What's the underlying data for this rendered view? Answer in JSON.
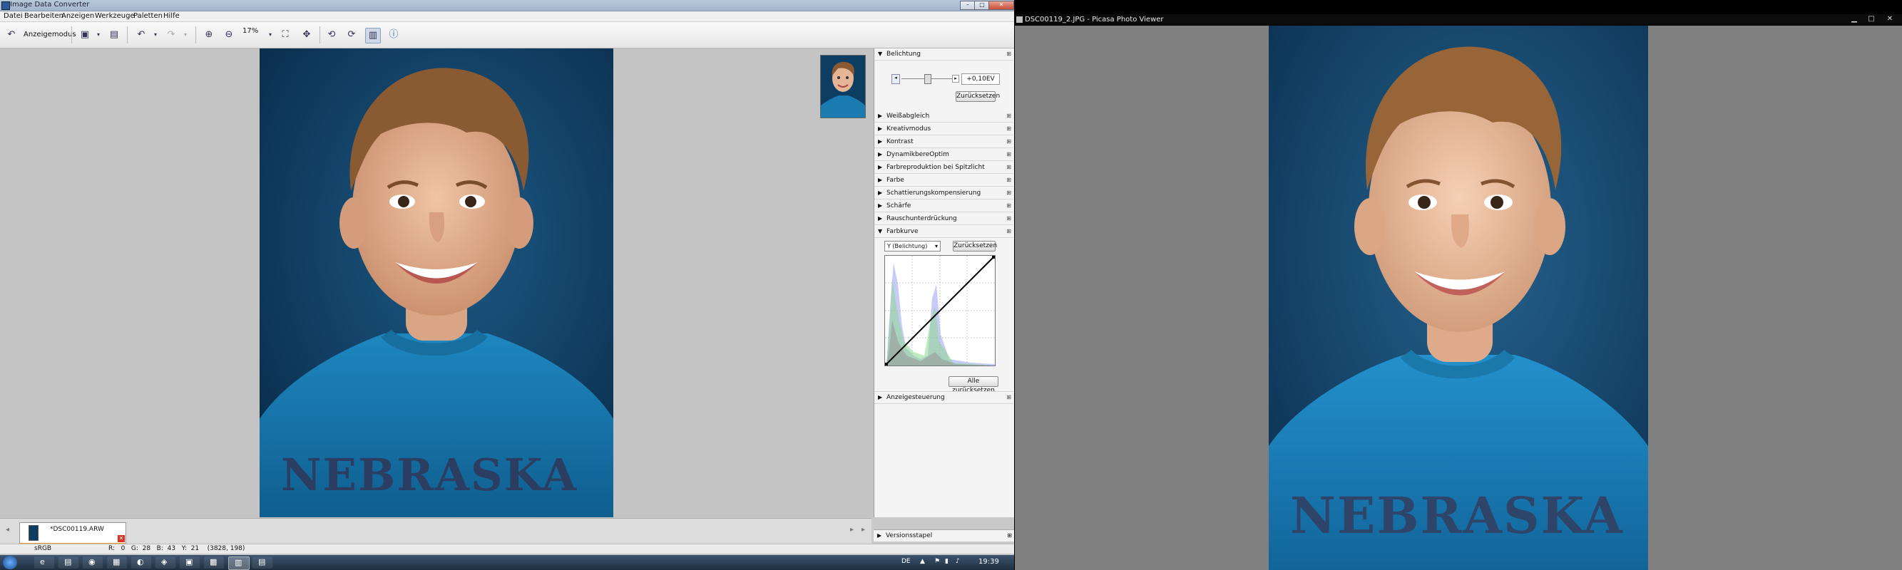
{
  "idc": {
    "title": "Image Data Converter",
    "window_buttons": [
      "–",
      "□",
      "✕"
    ],
    "menu": [
      "Datei",
      "Bearbeiten",
      "Anzeigen",
      "Werkzeuge",
      "Paletten",
      "Hilfe"
    ],
    "toolbar": {
      "mode_label": "Anzeigemodus",
      "zoom": "17%"
    },
    "panel": {
      "belichtung": {
        "title": "Belichtung",
        "value": "+0,10EV",
        "reset": "Zurücksetzen"
      },
      "sections": [
        "Weißabgleich",
        "Kreativmodus",
        "Kontrast",
        "DynamikbereOptim",
        "Farbreproduktion bei Spitzlicht",
        "Farbe",
        "Schattierungskompensierung",
        "Schärfe",
        "Rauschunterdrückung"
      ],
      "farbkurve": {
        "title": "Farbkurve",
        "channel": "Y (Belichtung)",
        "reset": "Zurücksetzen",
        "reset_all": "Alle zurücksetzen"
      },
      "anzeigesteuerung": "Anzeigesteuerung",
      "versionsstapel": "Versionsstapel"
    },
    "file_tab": "*DSC00119.ARW",
    "status": {
      "profile": "sRGB",
      "pixel": "R:   0   G:  28   B:  43   Y:  21    (3828, 198)"
    },
    "clock": "19:39",
    "language": "DE"
  },
  "picasa": {
    "title": "DSC00119_2.JPG - Picasa Photo Viewer",
    "buttons": [
      "▁",
      "□",
      "✕"
    ]
  },
  "colors": {
    "backdrop": "#0d3d63",
    "shirt": "#1b7ab0",
    "skin": "#e6b596",
    "hair": "#8a5a33"
  }
}
